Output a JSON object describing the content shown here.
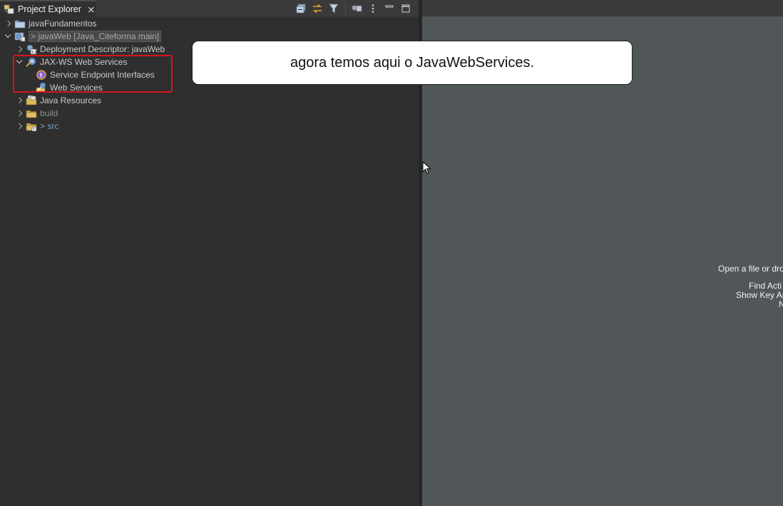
{
  "view": {
    "tab_title": "Project Explorer",
    "close_glyph": "⨯",
    "toolbar": [
      "collapse-all-icon",
      "link-with-editor-icon",
      "filter-icon",
      "focus-on-active-task-icon",
      "view-menu-icon",
      "minimize-icon",
      "maximize-icon"
    ]
  },
  "tree": {
    "items": [
      {
        "label": "javaFundamentos",
        "icon": "project-folder-icon",
        "expanded": false
      },
      {
        "label": "> javaWeb [Java_Citeforma main]",
        "icon": "web-project-icon",
        "expanded": true
      },
      {
        "label": "Deployment Descriptor: javaWeb",
        "icon": "deployment-descriptor-icon",
        "expanded": false
      },
      {
        "label": "JAX-WS Web Services",
        "icon": "jaxws-icon",
        "expanded": true
      },
      {
        "label": "Service Endpoint Interfaces",
        "icon": "service-endpoint-icon"
      },
      {
        "label": "Web Services",
        "icon": "web-services-icon"
      },
      {
        "label": "Java Resources",
        "icon": "java-resources-icon",
        "expanded": false
      },
      {
        "label": "build",
        "icon": "folder-icon",
        "expanded": false
      },
      {
        "label": "> src",
        "icon": "src-folder-icon",
        "expanded": false
      }
    ]
  },
  "callout": {
    "text": "agora temos aqui o JavaWebServices."
  },
  "editor": {
    "hints": [
      "Open a file or dro",
      "Find Acti",
      "Show Key As",
      "N"
    ]
  },
  "colors": {
    "highlight": "#d8141a",
    "panel": "#2f2f2f",
    "editor_bg": "#515658"
  }
}
